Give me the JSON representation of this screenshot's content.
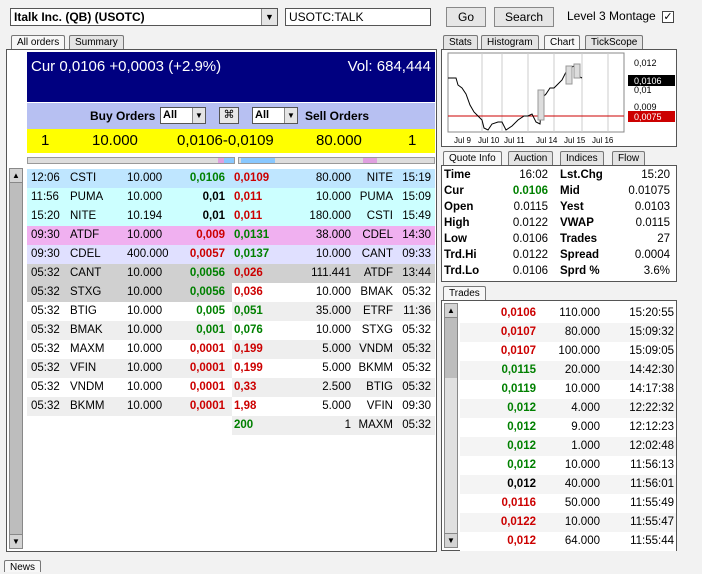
{
  "top": {
    "instrument": "Italk Inc. (QB) (USOTC)",
    "symbol": "USOTC:TALK",
    "go": "Go",
    "search": "Search",
    "montage_label": "Level 3 Montage",
    "montage_checked": "✓"
  },
  "left_tabs": [
    "All orders",
    "Summary"
  ],
  "header": {
    "cur": "Cur 0,0106 +0,0003 (+2.9%)",
    "vol": "Vol: 684,444"
  },
  "filters": {
    "buy_label": "Buy Orders",
    "buy_value": "All",
    "link_icon": "⌘",
    "sell_value": "All",
    "sell_label": "Sell Orders"
  },
  "summary_row": {
    "buy_count": "1",
    "buy_size": "10.000",
    "spread": "0,0106-0,0109",
    "sell_size": "80.000",
    "sell_count": "1"
  },
  "buy_orders": [
    {
      "time": "12:06",
      "mm": "CSTI",
      "size": "10.000",
      "price": "0,0106",
      "pc": "g"
    },
    {
      "time": "11:56",
      "mm": "PUMA",
      "size": "10.000",
      "price": "0,01",
      "pc": "k"
    },
    {
      "time": "15:20",
      "mm": "NITE",
      "size": "10.194",
      "price": "0,01",
      "pc": "k"
    },
    {
      "time": "09:30",
      "mm": "ATDF",
      "size": "10.000",
      "price": "0,009",
      "pc": "r"
    },
    {
      "time": "09:30",
      "mm": "CDEL",
      "size": "400.000",
      "price": "0,0057",
      "pc": "r"
    },
    {
      "time": "05:32",
      "mm": "CANT",
      "size": "10.000",
      "price": "0,0056",
      "pc": "g"
    },
    {
      "time": "05:32",
      "mm": "STXG",
      "size": "10.000",
      "price": "0,0056",
      "pc": "g"
    },
    {
      "time": "05:32",
      "mm": "BTIG",
      "size": "10.000",
      "price": "0,005",
      "pc": "g"
    },
    {
      "time": "05:32",
      "mm": "BMAK",
      "size": "10.000",
      "price": "0,001",
      "pc": "g"
    },
    {
      "time": "05:32",
      "mm": "MAXM",
      "size": "10.000",
      "price": "0,0001",
      "pc": "r"
    },
    {
      "time": "05:32",
      "mm": "VFIN",
      "size": "10.000",
      "price": "0,0001",
      "pc": "r"
    },
    {
      "time": "05:32",
      "mm": "VNDM",
      "size": "10.000",
      "price": "0,0001",
      "pc": "r"
    },
    {
      "time": "05:32",
      "mm": "BKMM",
      "size": "10.000",
      "price": "0,0001",
      "pc": "r"
    }
  ],
  "sell_orders": [
    {
      "price": "0,0109",
      "size": "80.000",
      "mm": "NITE",
      "time": "15:19",
      "pc": "r"
    },
    {
      "price": "0,011",
      "size": "10.000",
      "mm": "PUMA",
      "time": "15:09",
      "pc": "r"
    },
    {
      "price": "0,011",
      "size": "180.000",
      "mm": "CSTI",
      "time": "15:49",
      "pc": "r"
    },
    {
      "price": "0,0131",
      "size": "38.000",
      "mm": "CDEL",
      "time": "14:30",
      "pc": "g"
    },
    {
      "price": "0,0137",
      "size": "10.000",
      "mm": "CANT",
      "time": "09:33",
      "pc": "g"
    },
    {
      "price": "0,026",
      "size": "111.441",
      "mm": "ATDF",
      "time": "13:44",
      "pc": "r"
    },
    {
      "price": "0,036",
      "size": "10.000",
      "mm": "BMAK",
      "time": "05:32",
      "pc": "r"
    },
    {
      "price": "0,051",
      "size": "35.000",
      "mm": "ETRF",
      "time": "11:36",
      "pc": "g"
    },
    {
      "price": "0,076",
      "size": "10.000",
      "mm": "STXG",
      "time": "05:32",
      "pc": "g"
    },
    {
      "price": "0,199",
      "size": "5.000",
      "mm": "VNDM",
      "time": "05:32",
      "pc": "r"
    },
    {
      "price": "0,199",
      "size": "5.000",
      "mm": "BKMM",
      "time": "05:32",
      "pc": "r"
    },
    {
      "price": "0,33",
      "size": "2.500",
      "mm": "BTIG",
      "time": "05:32",
      "pc": "r"
    },
    {
      "price": "1,98",
      "size": "5.000",
      "mm": "VFIN",
      "time": "09:30",
      "pc": "r"
    },
    {
      "price": "200",
      "size": "1",
      "mm": "MAXM",
      "time": "05:32",
      "pc": "g"
    }
  ],
  "right_tabs_top": [
    "Stats",
    "Histogram",
    "Chart",
    "TickScope"
  ],
  "chart": {
    "x_labels": [
      "Jul 9",
      "Jul 10",
      "Jul 11",
      "Jul 14",
      "Jul 15",
      "Jul 16"
    ],
    "y_labels": [
      "0,012",
      "0,0106",
      "0,01",
      "0,009",
      "0,0075"
    ],
    "line_color": "#000000",
    "ref_color": "#cc0000"
  },
  "right_tabs_mid": [
    "Quote Info",
    "Auction",
    "Indices",
    "Flow"
  ],
  "quote": [
    [
      "Time",
      "16:02",
      "Lst.Chg",
      "15:20"
    ],
    [
      "Cur",
      "0.0106",
      "Mid",
      "0.01075"
    ],
    [
      "Open",
      "0.0115",
      "Yest",
      "0.0103"
    ],
    [
      "High",
      "0.0122",
      "VWAP",
      "0.0115"
    ],
    [
      "Low",
      "0.0106",
      "Trades",
      "27"
    ],
    [
      "Trd.Hi",
      "0.0122",
      "Spread",
      "0.0004"
    ],
    [
      "Trd.Lo",
      "0.0106",
      "Sprd %",
      "3.6%"
    ]
  ],
  "trades_tab": "Trades",
  "trades": [
    {
      "price": "0,0106",
      "size": "110.000",
      "time": "15:20:55",
      "pc": "r"
    },
    {
      "price": "0,0107",
      "size": "80.000",
      "time": "15:09:32",
      "pc": "r"
    },
    {
      "price": "0,0107",
      "size": "100.000",
      "time": "15:09:05",
      "pc": "r"
    },
    {
      "price": "0,0115",
      "size": "20.000",
      "time": "14:42:30",
      "pc": "g"
    },
    {
      "price": "0,0119",
      "size": "10.000",
      "time": "14:17:38",
      "pc": "g"
    },
    {
      "price": "0,012",
      "size": "4.000",
      "time": "12:22:32",
      "pc": "g"
    },
    {
      "price": "0,012",
      "size": "9.000",
      "time": "12:12:23",
      "pc": "g"
    },
    {
      "price": "0,012",
      "size": "1.000",
      "time": "12:02:48",
      "pc": "g"
    },
    {
      "price": "0,012",
      "size": "10.000",
      "time": "11:56:13",
      "pc": "g"
    },
    {
      "price": "0,012",
      "size": "40.000",
      "time": "11:56:01",
      "pc": "k"
    },
    {
      "price": "0,0116",
      "size": "50.000",
      "time": "11:55:49",
      "pc": "r"
    },
    {
      "price": "0,0122",
      "size": "10.000",
      "time": "11:55:47",
      "pc": "r"
    },
    {
      "price": "0,012",
      "size": "64.000",
      "time": "11:55:44",
      "pc": "r"
    }
  ],
  "bottom_tab": "News",
  "colors": {
    "red": "#cc0000",
    "green": "#008000",
    "navy": "#000080",
    "yellow": "#ffff00"
  }
}
